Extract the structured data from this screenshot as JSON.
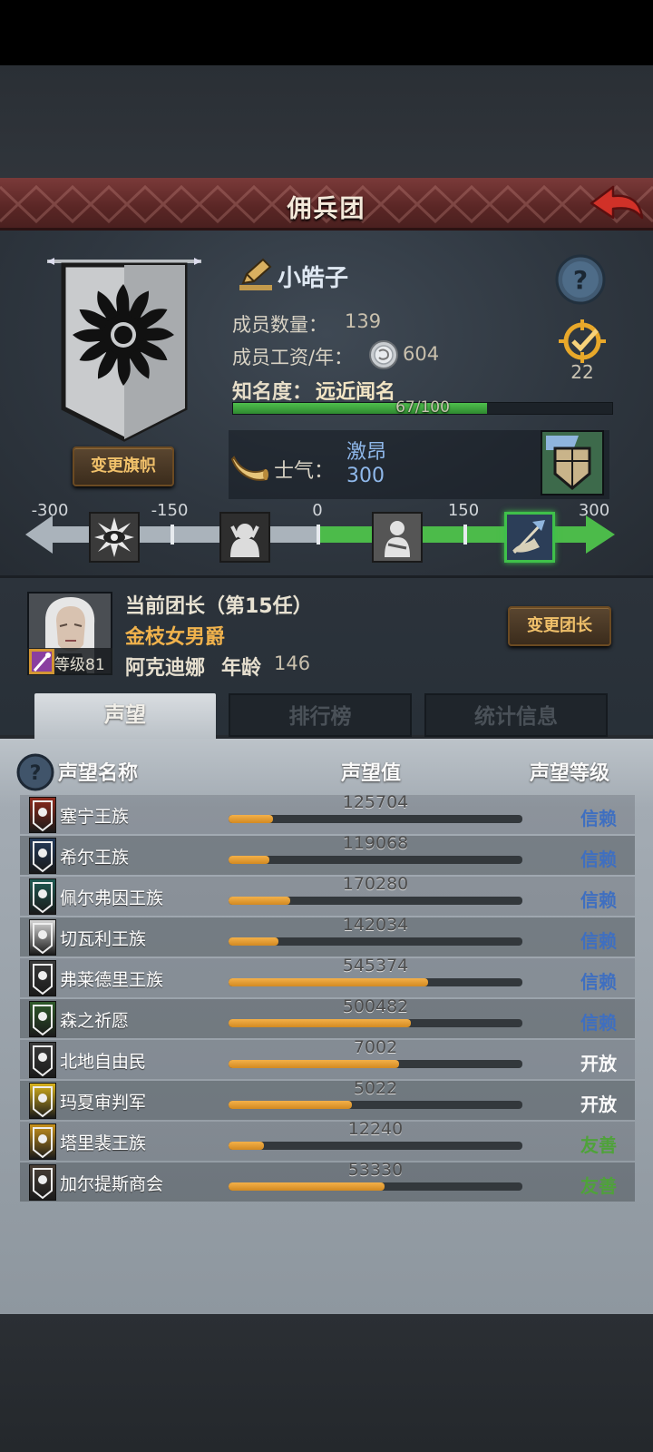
{
  "header": {
    "title": "佣兵团"
  },
  "guild": {
    "name": "小皓子",
    "members_label": "成员数量：",
    "members_value": "139",
    "salary_label": "成员工资/年：",
    "salary_value": "604",
    "fame_label": "知名度：",
    "fame_value": "远近闻名",
    "fame_progress_text": "67/100",
    "fame_progress": 0.67,
    "achievement_count": "22",
    "change_banner_label": "变更旗帜",
    "morale_label": "士气：",
    "morale_state": "激昂",
    "morale_value": "300"
  },
  "morale_scale": {
    "ticks": [
      "-300",
      "-150",
      "0",
      "150",
      "300"
    ],
    "current": 300
  },
  "leader": {
    "title": "当前团长（第15任）",
    "rank": "金枝女男爵",
    "level_label": "等级81",
    "name": "阿克迪娜",
    "age_label": "年龄",
    "age_value": "146",
    "change_leader_label": "变更团长"
  },
  "tabs": [
    {
      "label": "声望",
      "active": true
    },
    {
      "label": "排行榜",
      "active": false
    },
    {
      "label": "统计信息",
      "active": false
    }
  ],
  "reputation": {
    "headers": {
      "name": "声望名称",
      "value": "声望值",
      "level": "声望等级"
    },
    "rows": [
      {
        "name": "塞宁王族",
        "value": "125704",
        "fill": 0.15,
        "level": "信赖",
        "level_color": "#3f6fc0",
        "icon": "banner-sennin-icon",
        "icon_color": "#8e2a1c"
      },
      {
        "name": "希尔王族",
        "value": "119068",
        "fill": 0.14,
        "level": "信赖",
        "level_color": "#3f6fc0",
        "icon": "banner-hill-icon",
        "icon_color": "#233a5a"
      },
      {
        "name": "佩尔弗因王族",
        "value": "170280",
        "fill": 0.21,
        "level": "信赖",
        "level_color": "#3f6fc0",
        "icon": "banner-pelfin-icon",
        "icon_color": "#1f5a52"
      },
      {
        "name": "切瓦利王族",
        "value": "142034",
        "fill": 0.17,
        "level": "信赖",
        "level_color": "#3f6fc0",
        "icon": "banner-chevali-icon",
        "icon_color": "#d8d8d8"
      },
      {
        "name": "弗莱德里王族",
        "value": "545374",
        "fill": 0.68,
        "level": "信赖",
        "level_color": "#3f6fc0",
        "icon": "banner-fraderi-icon",
        "icon_color": "#3a3a3a"
      },
      {
        "name": "森之祈愿",
        "value": "500482",
        "fill": 0.62,
        "level": "信赖",
        "level_color": "#3f6fc0",
        "icon": "banner-forest-icon",
        "icon_color": "#2f5a2a"
      },
      {
        "name": "北地自由民",
        "value": "7002",
        "fill": 0.58,
        "level": "开放",
        "level_color": "#fafafa",
        "icon": "banner-north-icon",
        "icon_color": "#3b3b3b"
      },
      {
        "name": "玛夏审判军",
        "value": "5022",
        "fill": 0.42,
        "level": "开放",
        "level_color": "#fafafa",
        "icon": "banner-masha-icon",
        "icon_color": "#d8b21c"
      },
      {
        "name": "塔里裴王族",
        "value": "12240",
        "fill": 0.12,
        "level": "友善",
        "level_color": "#4fa23a",
        "icon": "banner-taripei-icon",
        "icon_color": "#c8921c"
      },
      {
        "name": "加尔提斯商会",
        "value": "53330",
        "fill": 0.53,
        "level": "友善",
        "level_color": "#4fa23a",
        "icon": "banner-galtis-icon",
        "icon_color": "#4a4036"
      }
    ]
  }
}
